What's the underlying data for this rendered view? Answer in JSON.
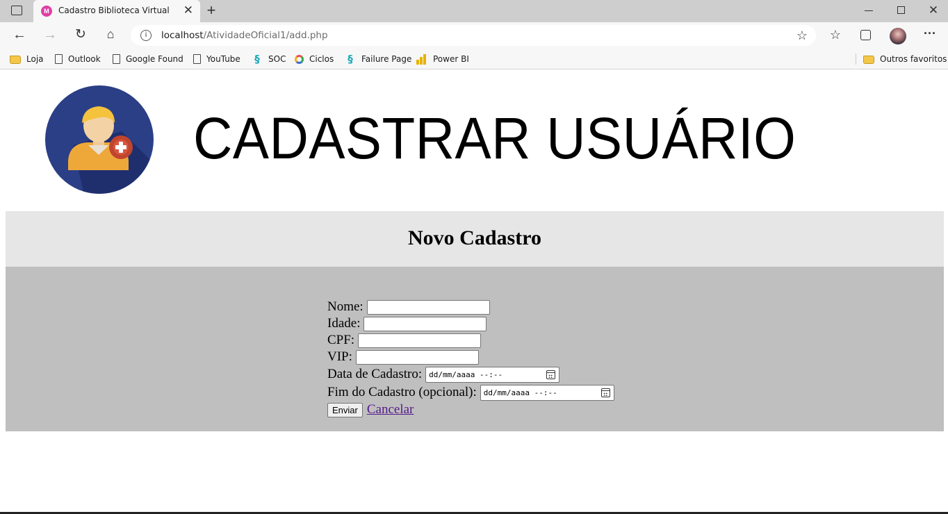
{
  "browser": {
    "tab_title": "Cadastro Biblioteca Virtual",
    "tab_favicon_text": "M",
    "url_host": "localhost",
    "url_path": "/AtividadeOficial1/add.php",
    "bookmarks": [
      {
        "label": "Loja",
        "icon": "folder-icon"
      },
      {
        "label": "Outlook",
        "icon": "page-icon"
      },
      {
        "label": "Google Found",
        "icon": "page-icon"
      },
      {
        "label": "YouTube",
        "icon": "page-icon"
      },
      {
        "label": "SOC",
        "icon": "soc-icon"
      },
      {
        "label": "Ciclos",
        "icon": "ring-icon"
      },
      {
        "label": "Failure Page",
        "icon": "soc-icon"
      },
      {
        "label": "Power BI",
        "icon": "powerbi-icon"
      }
    ],
    "other_favorites": "Outros favoritos"
  },
  "header": {
    "title": "CADASTRAR USUÁRIO"
  },
  "form": {
    "title": "Novo Cadastro",
    "fields": {
      "nome": {
        "label": "Nome:",
        "value": ""
      },
      "idade": {
        "label": "Idade:",
        "value": ""
      },
      "cpf": {
        "label": "CPF:",
        "value": ""
      },
      "vip": {
        "label": "VIP:",
        "value": ""
      },
      "data_cadastro": {
        "label": "Data de Cadastro:",
        "placeholder": "dd/mm/aaaa --:--"
      },
      "fim_cadastro": {
        "label": "Fim do Cadastro (opcional):",
        "placeholder": "dd/mm/aaaa --:--"
      }
    },
    "submit_label": "Enviar",
    "cancel_label": "Cancelar"
  },
  "colors": {
    "heading_band": "#e6e6e6",
    "form_band": "#bfbfbf",
    "logo_circle": "#2b3f86",
    "logo_badge": "#c0452e",
    "link_visited": "#551a8b"
  }
}
